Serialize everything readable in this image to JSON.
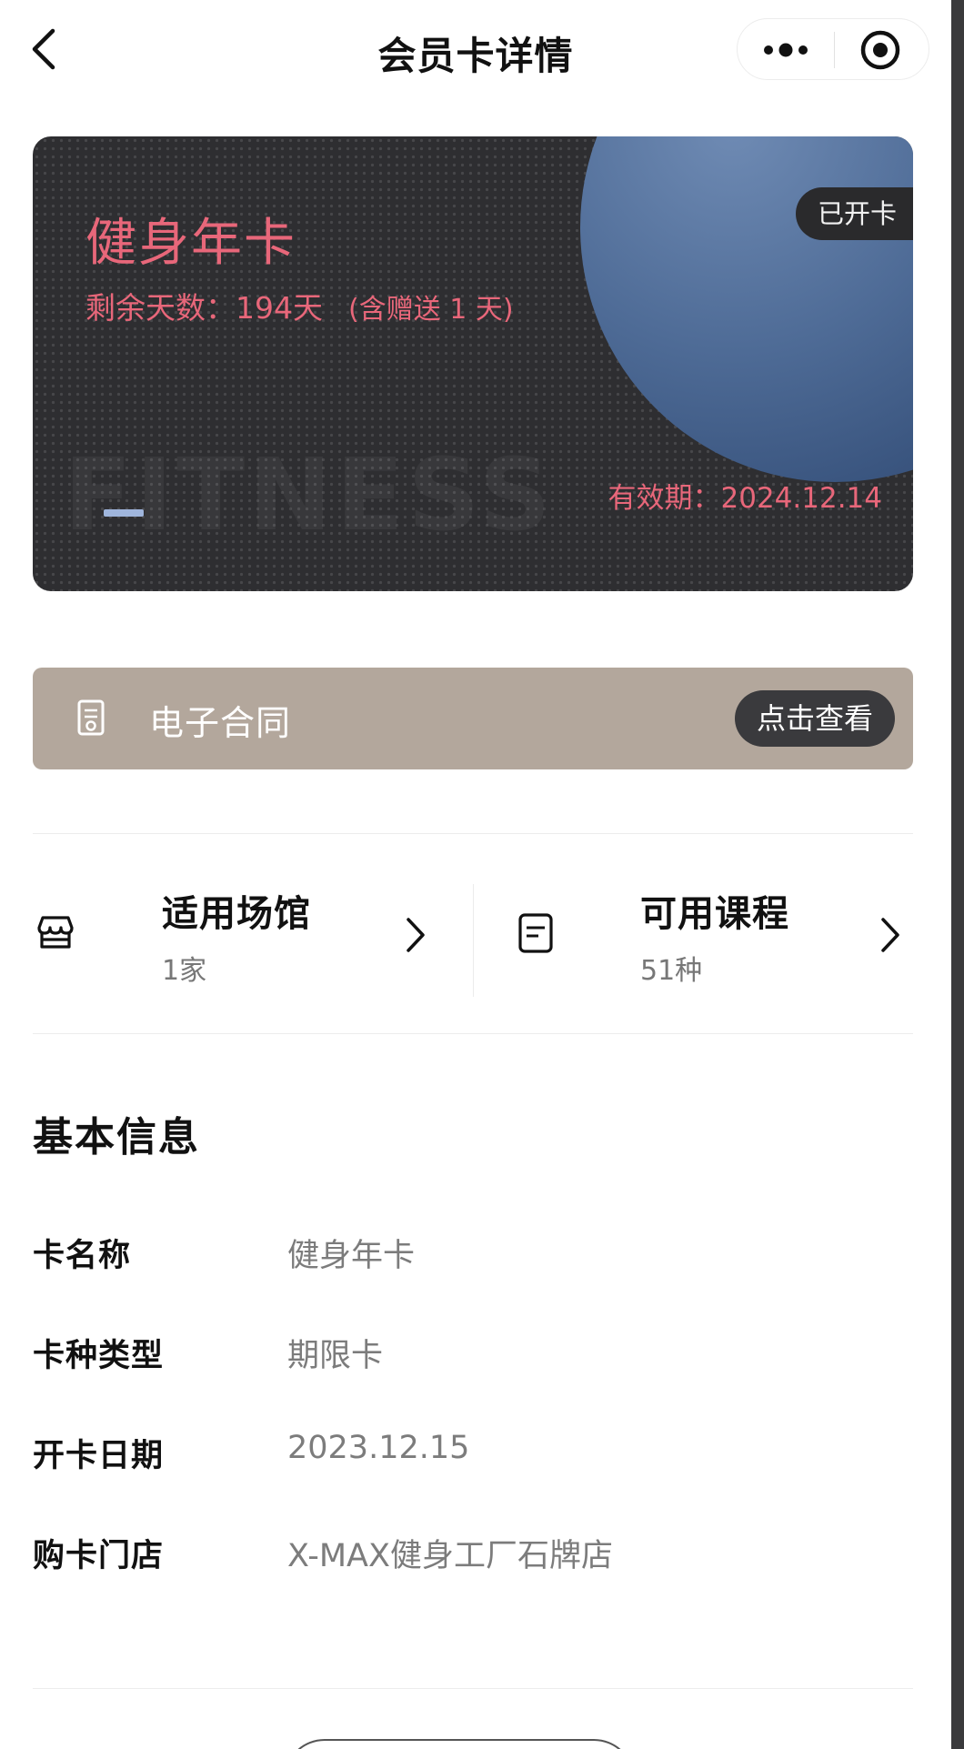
{
  "header": {
    "title": "会员卡详情"
  },
  "card": {
    "name": "健身年卡",
    "remaining_label": "剩余天数：194天",
    "bonus_note": "(含赠送 1 天)",
    "status_badge": "已开卡",
    "validity": "有效期：2024.12.14",
    "watermark": "FITNESS",
    "text_color": "#e8677a",
    "orb_color": "#4e6b96"
  },
  "contract": {
    "label": "电子合同",
    "button": "点击查看",
    "bar_color": "#b3a79c"
  },
  "quick_links": [
    {
      "title": "适用场馆",
      "subtitle": "1家",
      "icon": "store-icon"
    },
    {
      "title": "可用课程",
      "subtitle": "51种",
      "icon": "document-icon"
    }
  ],
  "basic_info": {
    "title": "基本信息",
    "rows": [
      {
        "label": "卡名称",
        "value": "健身年卡"
      },
      {
        "label": "卡种类型",
        "value": "期限卡"
      },
      {
        "label": "开卡日期",
        "value": "2023.12.15"
      },
      {
        "label": "购卡门店",
        "value": "X-MAX健身工厂石牌店"
      }
    ]
  }
}
